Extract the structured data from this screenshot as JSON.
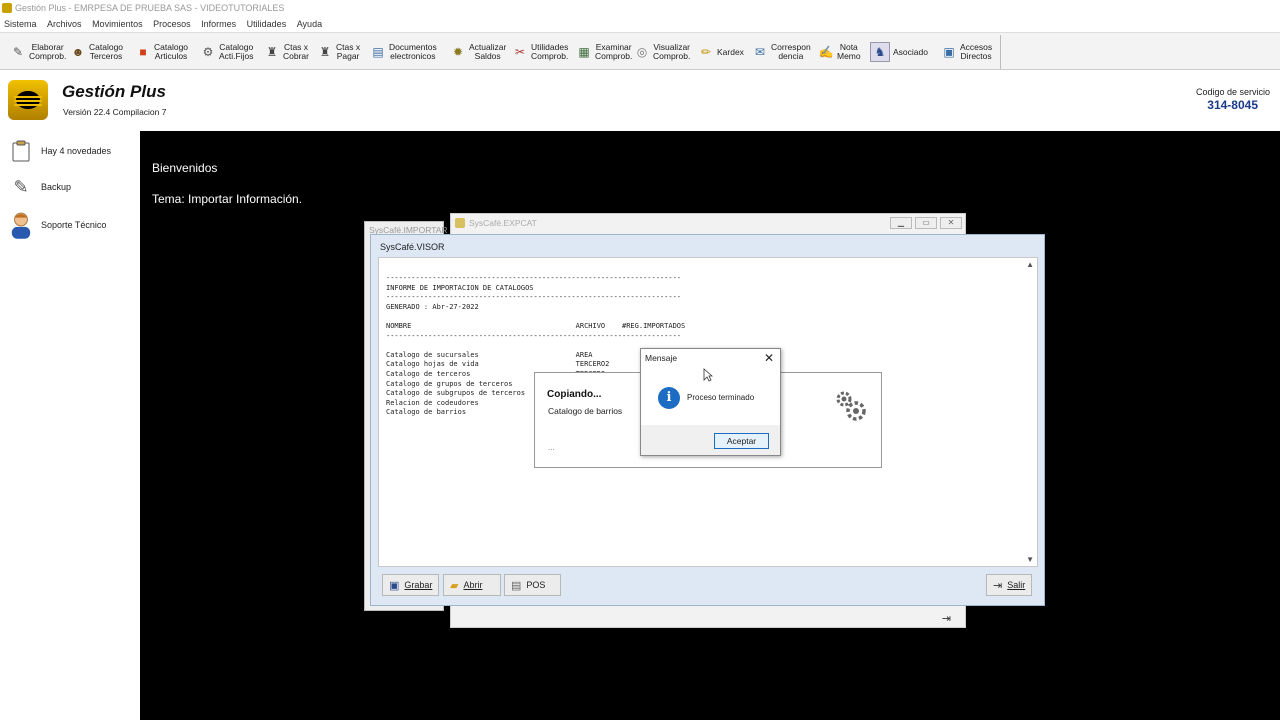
{
  "window": {
    "title": "Gestión Plus - EMRPESA DE PRUEBA SAS - VIDEOTUTORIALES"
  },
  "menu": [
    "Sistema",
    "Archivos",
    "Movimientos",
    "Procesos",
    "Informes",
    "Utilidades",
    "Ayuda"
  ],
  "toolbar": [
    {
      "l1": "Elaborar",
      "l2": "Comprob.",
      "icon": "pencil-doc-icon",
      "glyph": "✎",
      "color": "#555"
    },
    {
      "l1": "Catalogo",
      "l2": "Terceros",
      "icon": "person-icon",
      "glyph": "☻",
      "color": "#6b4a1e"
    },
    {
      "l1": "Catalogo",
      "l2": "Articulos",
      "icon": "box-icon",
      "glyph": "■",
      "color": "#d0401a"
    },
    {
      "l1": "Catalogo",
      "l2": "Acti.Fijos",
      "icon": "wrench-icon",
      "glyph": "⚙",
      "color": "#555"
    },
    {
      "l1": "Ctas x",
      "l2": "Cobrar",
      "icon": "stamp-icon",
      "glyph": "♜",
      "color": "#444"
    },
    {
      "l1": "Ctas x",
      "l2": "Pagar",
      "icon": "stamp-icon",
      "glyph": "♜",
      "color": "#444"
    },
    {
      "l1": "Documentos",
      "l2": "electronicos",
      "icon": "documents-icon",
      "glyph": "▤",
      "color": "#3a6ea5"
    },
    {
      "l1": "Actualizar",
      "l2": "Saldos",
      "icon": "gear-icon",
      "glyph": "✹",
      "color": "#8a7a20"
    },
    {
      "l1": "Utilidades",
      "l2": "Comprob.",
      "icon": "tools-icon",
      "glyph": "✂",
      "color": "#b03030"
    },
    {
      "l1": "Examinar",
      "l2": "Comprob.",
      "icon": "grid-icon",
      "glyph": "▦",
      "color": "#3a6a3a"
    },
    {
      "l1": "Visualizar",
      "l2": "Comprob.",
      "icon": "magnifier-icon",
      "glyph": "◎",
      "color": "#777"
    },
    {
      "l1": "Kardex",
      "l2": "",
      "icon": "pencil-icon",
      "glyph": "✏",
      "color": "#c09000"
    },
    {
      "l1": "Correspon",
      "l2": "dencia",
      "icon": "mail-icon",
      "glyph": "✉",
      "color": "#3a6ea5"
    },
    {
      "l1": "Nota",
      "l2": "Memo",
      "icon": "note-icon",
      "glyph": "✍",
      "color": "#b03030"
    },
    {
      "l1": "Asociado",
      "l2": "",
      "icon": "associate-icon",
      "glyph": "♞",
      "color": "#2a4a8a"
    },
    {
      "l1": "Accesos",
      "l2": "Directos",
      "icon": "folder-icon",
      "glyph": "▣",
      "color": "#3a6ea5"
    }
  ],
  "header": {
    "app_name": "Gestión Plus",
    "version": "Versión 22.4  Compilacion 7",
    "service_label": "Codigo de servicio",
    "service_number": "314-8045"
  },
  "sidebar": [
    {
      "label": "Hay 4 novedades",
      "icon": "clipboard-icon",
      "glyph": "📋"
    },
    {
      "label": "Backup",
      "icon": "edit-icon",
      "glyph": "✎"
    },
    {
      "label": "Soporte Técnico",
      "icon": "support-agent-icon",
      "glyph": "☺"
    }
  ],
  "main": {
    "welcome": "Bienvenidos",
    "topic": "Tema: Importar Información."
  },
  "windows": {
    "importar_title": "SysCafé.IMPORTAR",
    "expcat_title": "SysCafé.EXPCAT",
    "visor_title": "SysCafé.VISOR"
  },
  "report": {
    "text": "----------------------------------------------------------------------\nINFORME DE IMPORTACION DE CATALOGOS\n----------------------------------------------------------------------\nGENERADO : Abr-27-2022\n\nNOMBRE                                       ARCHIVO    #REG.IMPORTADOS\n----------------------------------------------------------------------\n\nCatalogo de sucursales                       AREA\nCatalogo hojas de vida                       TERCERO2\nCatalogo de terceros                         TERCERO\nCatalogo de grupos de terceros\nCatalogo de subgrupos de terceros\nRelacion de codeudores\nCatalogo de barrios"
  },
  "visor_buttons": {
    "grabar": "Grabar",
    "abrir": "Abrir",
    "pos": "POS",
    "salir": "Salir"
  },
  "copiando": {
    "title": "Copiando...",
    "subtitle": "Catalogo de barrios",
    "dots": "..."
  },
  "message": {
    "title": "Mensaje",
    "text": "Proceso terminado",
    "ok": "Aceptar",
    "info_glyph": "i"
  }
}
